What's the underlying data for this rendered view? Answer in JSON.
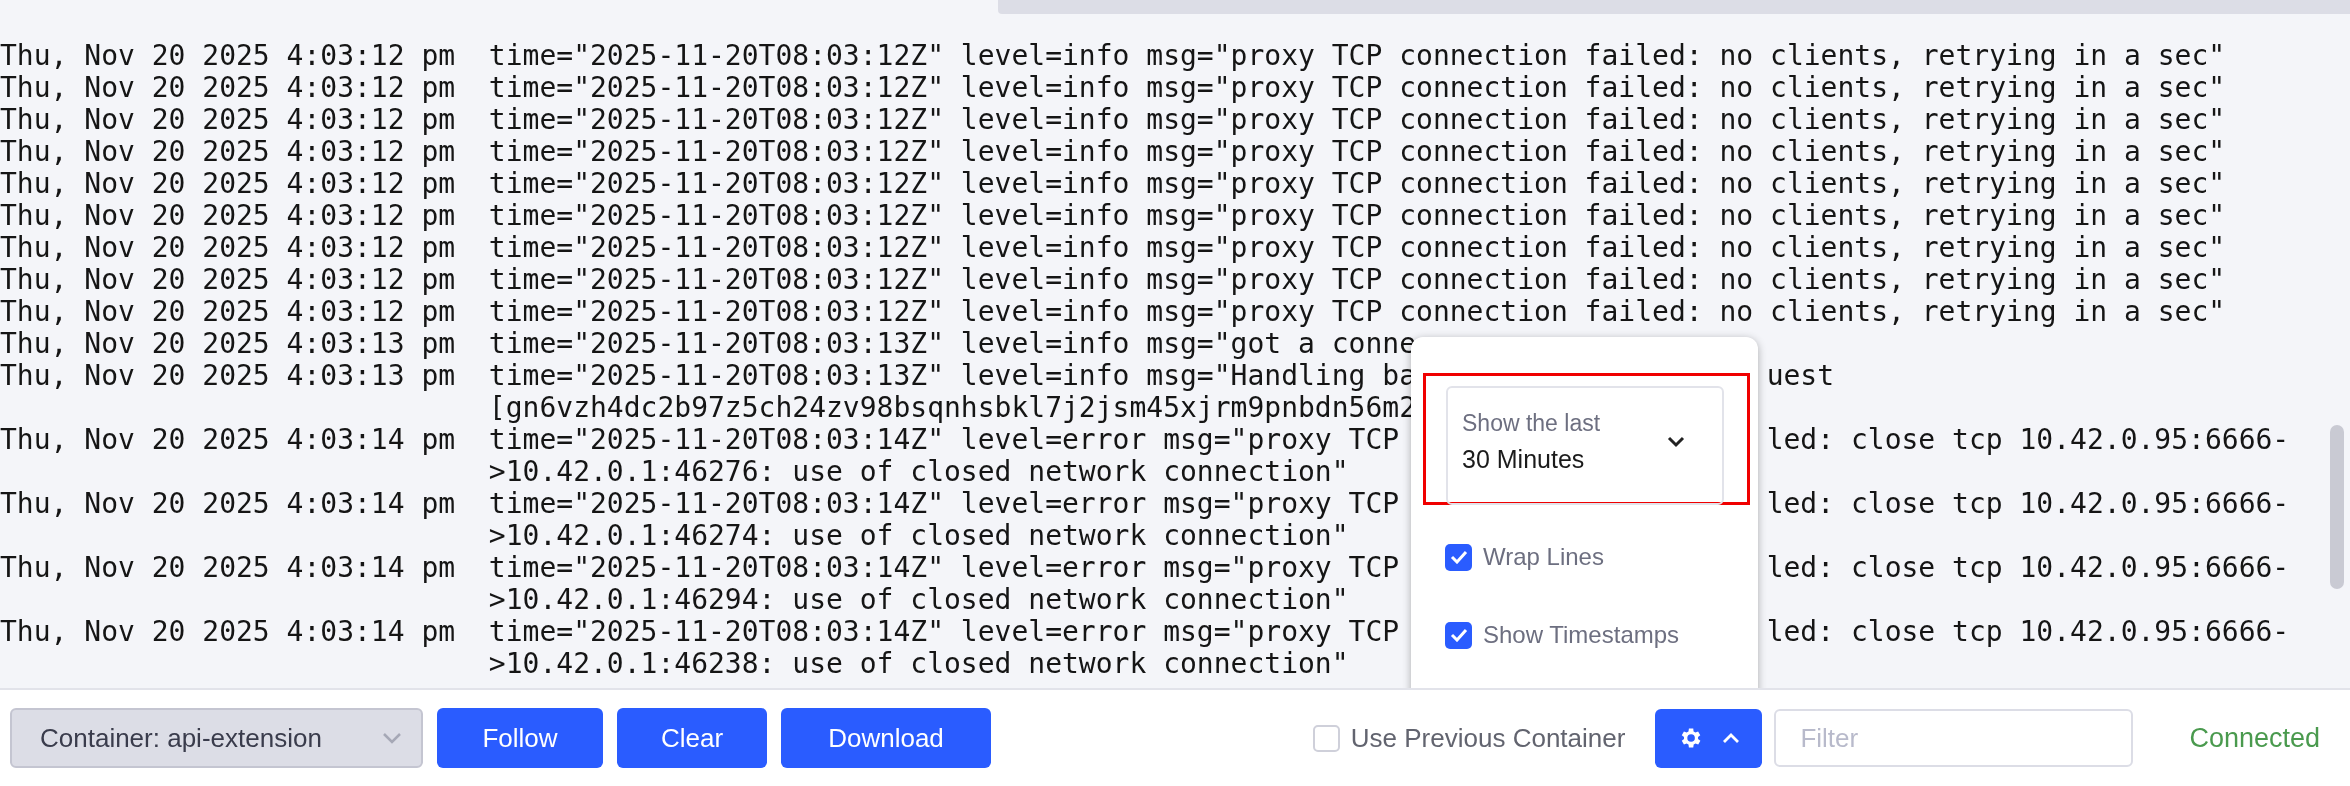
{
  "log": {
    "entries": [
      {
        "timestamp": "Thu, Nov 20 2025 4:03:12 pm",
        "lines": [
          {
            "text": "time=\"2025-11-20T08:03:12Z\" level=info msg=\"proxy TCP connection failed: no clients, retrying in a sec\""
          }
        ]
      },
      {
        "timestamp": "Thu, Nov 20 2025 4:03:12 pm",
        "lines": [
          {
            "text": "time=\"2025-11-20T08:03:12Z\" level=info msg=\"proxy TCP connection failed: no clients, retrying in a sec\""
          }
        ]
      },
      {
        "timestamp": "Thu, Nov 20 2025 4:03:12 pm",
        "lines": [
          {
            "text": "time=\"2025-11-20T08:03:12Z\" level=info msg=\"proxy TCP connection failed: no clients, retrying in a sec\""
          }
        ]
      },
      {
        "timestamp": "Thu, Nov 20 2025 4:03:12 pm",
        "lines": [
          {
            "text": "time=\"2025-11-20T08:03:12Z\" level=info msg=\"proxy TCP connection failed: no clients, retrying in a sec\""
          }
        ]
      },
      {
        "timestamp": "Thu, Nov 20 2025 4:03:12 pm",
        "lines": [
          {
            "text": "time=\"2025-11-20T08:03:12Z\" level=info msg=\"proxy TCP connection failed: no clients, retrying in a sec\""
          }
        ]
      },
      {
        "timestamp": "Thu, Nov 20 2025 4:03:12 pm",
        "lines": [
          {
            "text": "time=\"2025-11-20T08:03:12Z\" level=info msg=\"proxy TCP connection failed: no clients, retrying in a sec\""
          }
        ]
      },
      {
        "timestamp": "Thu, Nov 20 2025 4:03:12 pm",
        "lines": [
          {
            "text": "time=\"2025-11-20T08:03:12Z\" level=info msg=\"proxy TCP connection failed: no clients, retrying in a sec\""
          }
        ]
      },
      {
        "timestamp": "Thu, Nov 20 2025 4:03:12 pm",
        "lines": [
          {
            "text": "time=\"2025-11-20T08:03:12Z\" level=info msg=\"proxy TCP connection failed: no clients, retrying in a sec\""
          }
        ]
      },
      {
        "timestamp": "Thu, Nov 20 2025 4:03:12 pm",
        "lines": [
          {
            "text": "time=\"2025-11-20T08:03:12Z\" level=info msg=\"proxy TCP connection failed: no clients, retrying in a sec\""
          }
        ]
      },
      {
        "timestamp": "Thu, Nov 20 2025 4:03:13 pm",
        "lines": [
          {
            "text": "time=\"2025-11-20T08:03:13Z\" level=info msg=\"got a conne"
          }
        ]
      },
      {
        "timestamp": "Thu, Nov 20 2025 4:03:13 pm",
        "lines": [
          {
            "text": "time=\"2025-11-20T08:03:13Z\" level=info msg=\"Handling ba",
            "text_right": "uest"
          },
          {
            "text": "[gn6vzh4dc2b97z5ch24zv98bsqnhsbkl7j2jsm45xjrm9pnbdn56m2"
          }
        ]
      },
      {
        "timestamp": "Thu, Nov 20 2025 4:03:14 pm",
        "lines": [
          {
            "text": "time=\"2025-11-20T08:03:14Z\" level=error msg=\"proxy TCP",
            "text_right": "led: close tcp 10.42.0.95:6666-"
          },
          {
            "text": ">10.42.0.1:46276: use of closed network connection\""
          }
        ]
      },
      {
        "timestamp": "Thu, Nov 20 2025 4:03:14 pm",
        "lines": [
          {
            "text": "time=\"2025-11-20T08:03:14Z\" level=error msg=\"proxy TCP",
            "text_right": "led: close tcp 10.42.0.95:6666-"
          },
          {
            "text": ">10.42.0.1:46274: use of closed network connection\""
          }
        ]
      },
      {
        "timestamp": "Thu, Nov 20 2025 4:03:14 pm",
        "lines": [
          {
            "text": "time=\"2025-11-20T08:03:14Z\" level=error msg=\"proxy TCP",
            "text_right": "led: close tcp 10.42.0.95:6666-"
          },
          {
            "text": ">10.42.0.1:46294: use of closed network connection\""
          }
        ]
      },
      {
        "timestamp": "Thu, Nov 20 2025 4:03:14 pm",
        "lines": [
          {
            "text": "time=\"2025-11-20T08:03:14Z\" level=error msg=\"proxy TCP",
            "text_right": "led: close tcp 10.42.0.95:6666-"
          },
          {
            "text": ">10.42.0.1:46238: use of closed network connection\""
          }
        ]
      }
    ]
  },
  "settings_popup": {
    "time_range": {
      "label": "Show the last",
      "value": "30 Minutes",
      "highlighted": true
    },
    "options": [
      {
        "label": "Wrap Lines",
        "checked": true
      },
      {
        "label": "Show Timestamps",
        "checked": true
      }
    ]
  },
  "toolbar": {
    "container_select": {
      "value": "Container: api-extension",
      "disabled": true
    },
    "buttons": [
      "Follow",
      "Clear",
      "Download"
    ],
    "use_previous_container": {
      "label": "Use Previous Container",
      "checked": false
    },
    "filter": {
      "placeholder": "Filter"
    },
    "settings_button": {
      "expanded": true
    },
    "status": "Connected"
  }
}
